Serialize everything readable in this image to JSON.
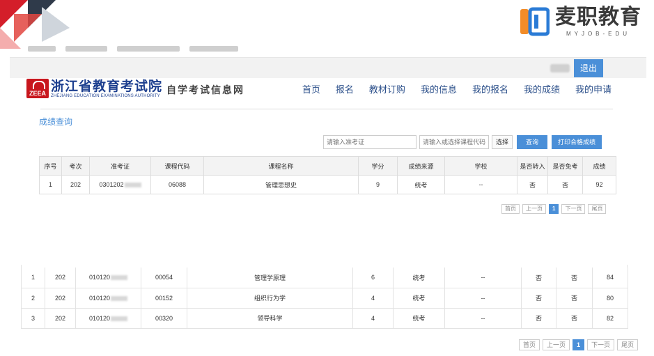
{
  "brand": {
    "name": "麦职教育",
    "sub": "MYJOB-EDU",
    "accent": "#2a7bd6",
    "accent2": "#f28c28"
  },
  "topbar": {
    "logout_label": "退出",
    "bg": "#f2f2f2"
  },
  "site": {
    "logo_seal_text": "ZEEA",
    "title_cn": "浙江省教育考试院",
    "title_en": "ZHEJIANG EDUCATION EXAMINATIONS AUTHORITY",
    "subtitle": "自学考试信息网"
  },
  "nav": {
    "items": [
      {
        "label": "首页"
      },
      {
        "label": "报名"
      },
      {
        "label": "教材订购"
      },
      {
        "label": "我的信息"
      },
      {
        "label": "我的报名"
      },
      {
        "label": "我的成绩"
      },
      {
        "label": "我的申请"
      }
    ]
  },
  "section_title": "成绩查询",
  "filters": {
    "cert_placeholder": "请输入准考证",
    "course_placeholder": "请输入或选择课程代码",
    "select_label": "选择",
    "query_label": "查询",
    "print_label": "打印合格成绩"
  },
  "table": {
    "headers": [
      "序号",
      "考次",
      "准考证",
      "课程代码",
      "课程名称",
      "学分",
      "成绩来源",
      "学校",
      "是否转入",
      "是否免考",
      "成绩"
    ],
    "rows": [
      {
        "no": "1",
        "session": "202",
        "cert_prefix": "0301202",
        "code": "06088",
        "name": "管理思想史",
        "credit": "9",
        "source": "统考",
        "school": "--",
        "transferred": "否",
        "exempt": "否",
        "score": "92"
      }
    ]
  },
  "pager1": {
    "first": "首页",
    "prev": "上一页",
    "current": "1",
    "next": "下一页",
    "last": "尾页"
  },
  "table2": {
    "rows": [
      {
        "no": "1",
        "session": "202",
        "cert_prefix": "010120",
        "code": "00054",
        "name": "管理学原理",
        "credit": "6",
        "source": "统考",
        "school": "--",
        "transferred": "否",
        "exempt": "否",
        "score": "84"
      },
      {
        "no": "2",
        "session": "202",
        "cert_prefix": "010120",
        "code": "00152",
        "name": "组织行为学",
        "credit": "4",
        "source": "统考",
        "school": "--",
        "transferred": "否",
        "exempt": "否",
        "score": "80"
      },
      {
        "no": "3",
        "session": "202",
        "cert_prefix": "010120",
        "code": "00320",
        "name": "领导科学",
        "credit": "4",
        "source": "统考",
        "school": "--",
        "transferred": "否",
        "exempt": "否",
        "score": "82"
      }
    ]
  },
  "pager2": {
    "first": "首页",
    "prev": "上一页",
    "current": "1",
    "next": "下一页",
    "last": "尾页"
  }
}
